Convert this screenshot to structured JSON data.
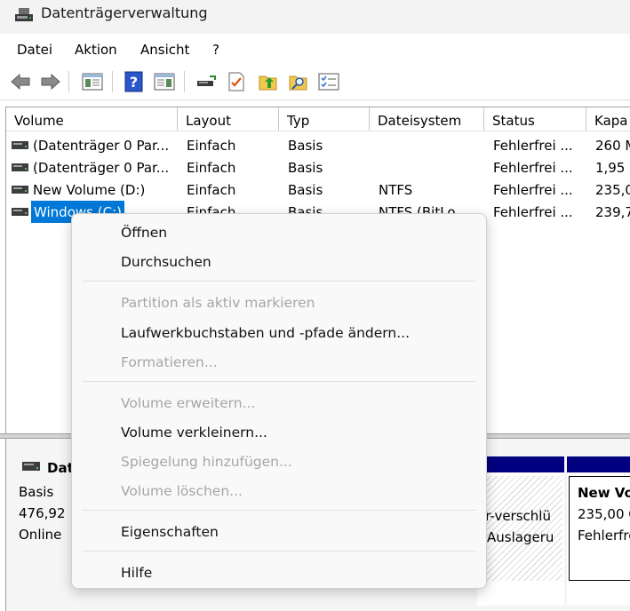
{
  "window": {
    "title": "Datenträgerverwaltung"
  },
  "menu": [
    "Datei",
    "Aktion",
    "Ansicht",
    "?"
  ],
  "toolbar": {
    "icons": [
      "back-arrow-icon",
      "forward-arrow-icon",
      "show-hide-tree-icon",
      "help-icon",
      "properties-pane-icon",
      "connect-disk-icon",
      "checklist-icon",
      "folder-up-icon",
      "search-folder-icon",
      "settings-list-icon"
    ]
  },
  "volume_table": {
    "columns": [
      "Volume",
      "Layout",
      "Typ",
      "Dateisystem",
      "Status",
      "Kapa"
    ],
    "rows": [
      {
        "volume": "(Datenträger 0 Par...",
        "layout": "Einfach",
        "typ": "Basis",
        "fs": "",
        "status": "Fehlerfrei ...",
        "kap": "260 M"
      },
      {
        "volume": "(Datenträger 0 Par...",
        "layout": "Einfach",
        "typ": "Basis",
        "fs": "",
        "status": "Fehlerfrei ...",
        "kap": "1,95 G"
      },
      {
        "volume": "New Volume (D:)",
        "layout": "Einfach",
        "typ": "Basis",
        "fs": "NTFS",
        "status": "Fehlerfrei ...",
        "kap": "235,0"
      },
      {
        "volume": "Windows (C:)",
        "layout": "Einfach",
        "typ": "Basis",
        "fs": "NTFS (BitLo",
        "status": "Fehlerfrei ...",
        "kap": "239,7"
      }
    ]
  },
  "disk_panel": {
    "name": "Dat",
    "type": "Basis",
    "size": "476,92",
    "state": "Online",
    "partition_c": {
      "line1": "er-verschlü",
      "line2": "Auslageru"
    },
    "partition_d": {
      "title": "New Vo",
      "size": "235,00 G",
      "status": "Fehlerfre"
    }
  },
  "context_menu": {
    "items": [
      {
        "label": "Öffnen",
        "enabled": true
      },
      {
        "label": "Durchsuchen",
        "enabled": true
      },
      {
        "label": "Partition als aktiv markieren",
        "enabled": false
      },
      {
        "label": "Laufwerkbuchstaben und -pfade ändern...",
        "enabled": true
      },
      {
        "label": "Formatieren...",
        "enabled": false
      },
      {
        "label": "Volume erweitern...",
        "enabled": false
      },
      {
        "label": "Volume verkleinern...",
        "enabled": true
      },
      {
        "label": "Spiegelung hinzufügen...",
        "enabled": false
      },
      {
        "label": "Volume löschen...",
        "enabled": false
      },
      {
        "label": "Eigenschaften",
        "enabled": true
      },
      {
        "label": "Hilfe",
        "enabled": true
      }
    ]
  },
  "colors": {
    "selection": "#0078d7",
    "partition_bar": "#000080"
  }
}
